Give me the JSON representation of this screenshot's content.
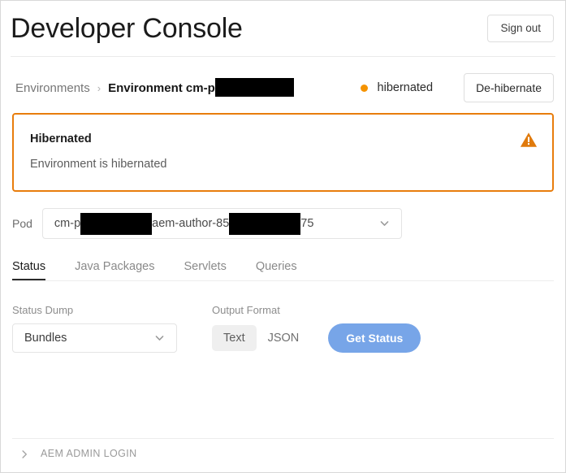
{
  "header": {
    "title": "Developer Console",
    "sign_out_label": "Sign out"
  },
  "breadcrumb": {
    "root_label": "Environments",
    "separator": "›",
    "current_label": "Environment cm-p",
    "current_redacted": true
  },
  "environment_status": {
    "state_label": "hibernated",
    "dot_color": "#f59300",
    "action_label": "De-hibernate"
  },
  "alert": {
    "title": "Hibernated",
    "message": "Environment is hibernated",
    "icon": "warning-triangle-icon",
    "border_color": "#e87d0d",
    "icon_color": "#e07a0c"
  },
  "pod": {
    "label": "Pod",
    "value_part_1": "cm-p",
    "value_part_2": "aem-author-85",
    "value_part_3": "75",
    "chevron_icon": "chevron-down-icon"
  },
  "tabs": [
    {
      "label": "Status",
      "active": true
    },
    {
      "label": "Java Packages",
      "active": false
    },
    {
      "label": "Servlets",
      "active": false
    },
    {
      "label": "Queries",
      "active": false
    }
  ],
  "controls": {
    "status_dump": {
      "label": "Status Dump",
      "value": "Bundles",
      "chevron_icon": "chevron-down-icon"
    },
    "output_format": {
      "label": "Output Format",
      "options": [
        {
          "label": "Text",
          "selected": true
        },
        {
          "label": "JSON",
          "selected": false
        }
      ]
    },
    "submit": {
      "label": "Get Status",
      "color": "#77a5e8"
    }
  },
  "footer": {
    "accordion_label": "AEM ADMIN LOGIN",
    "chevron_icon": "chevron-right-icon"
  }
}
